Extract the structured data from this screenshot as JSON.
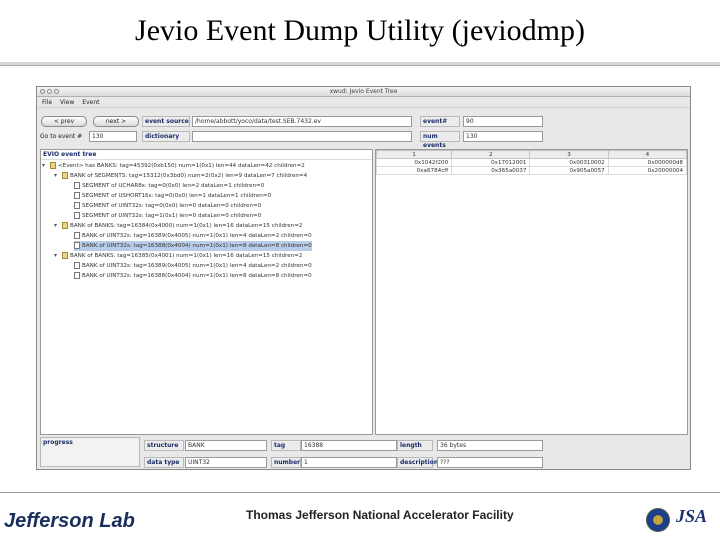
{
  "slide": {
    "title": "Jevio Event Dump Utility (jeviodmp)",
    "facility": "Thomas Jefferson National Accelerator Facility",
    "logo_text": "Jefferson Lab",
    "jsa_text": "JSA"
  },
  "window": {
    "title": "xwud: Jevio Event Tree",
    "menu": [
      "File",
      "View",
      "Event"
    ]
  },
  "toolbar": {
    "prev_label": "< prev",
    "next_label": "next >",
    "goto_label": "Go to event #",
    "goto_value": "130",
    "event_source_label": "event source",
    "event_source_value": "/home/abbott/yoco/data/test.SEB.7432.ev",
    "dictionary_label": "dictionary",
    "dictionary_value": "",
    "event_num_label": "event#",
    "event_num_value": "90",
    "num_events_label": "num events",
    "num_events_value": "130"
  },
  "tree": {
    "header": "EVIO event tree",
    "nodes": [
      {
        "text": "<Event> has BANKS: tag=45392(0xb150) num=1(0x1) len=44 dataLen=42 children=2",
        "toggle": "▾",
        "icon": "folder"
      },
      {
        "text": "BANK of SEGMENTS: tag=15312(0x3bd0) num=2(0x2) len=9 dataLen=7 children=4",
        "toggle": "▾",
        "icon": "folder"
      },
      {
        "text": "SEGMENT of UCHAR8s: tag=0(0x0) len=2 dataLen=1 children=0",
        "toggle": "",
        "icon": "file"
      },
      {
        "text": "SEGMENT of USHORT16s: tag=0(0x0) len=1 dataLen=1 children=0",
        "toggle": "",
        "icon": "file"
      },
      {
        "text": "SEGMENT of UINT32s: tag=0(0x0) len=0 dataLen=0 children=0",
        "toggle": "",
        "icon": "file"
      },
      {
        "text": "SEGMENT of UINT32s: tag=1(0x1) len=0 dataLen=0 children=0",
        "toggle": "",
        "icon": "file"
      },
      {
        "text": "BANK of BANKS: tag=16384(0x4000) num=1(0x1) len=16 dataLen=15 children=2",
        "toggle": "▾",
        "icon": "folder"
      },
      {
        "text": "BANK of UINT32s: tag=16389(0x4005) num=1(0x1) len=4 dataLen=2 children=0",
        "toggle": "",
        "icon": "file"
      },
      {
        "text": "BANK of UINT32s: tag=16388(0x4004) num=1(0x1) len=8 dataLen=8 children=0",
        "toggle": "",
        "icon": "file",
        "selected": true
      },
      {
        "text": "BANK of BANKS: tag=16385(0x4001) num=1(0x1) len=16 dataLen=15 children=2",
        "toggle": "▾",
        "icon": "folder"
      },
      {
        "text": "BANK of UINT32s: tag=16389(0x4005) num=1(0x1) len=4 dataLen=2 children=0",
        "toggle": "",
        "icon": "file"
      },
      {
        "text": "BANK of UINT32s: tag=16388(0x4004) num=1(0x1) len=8 dataLen=8 children=0",
        "toggle": "",
        "icon": "file"
      }
    ]
  },
  "table": {
    "headers": [
      "1",
      "2",
      "3",
      "4"
    ],
    "rows": [
      [
        "0x1042f200",
        "0x17012001",
        "0x00310002",
        "0x000000d8"
      ],
      [
        "0xa6784cff",
        "0x365a0037",
        "0x905a0057",
        "0x20000004"
      ]
    ]
  },
  "progress": {
    "label": "progress"
  },
  "details": {
    "structure_label": "structure",
    "structure_value": "BANK",
    "tag_label": "tag",
    "tag_value": "16388",
    "length_label": "length",
    "length_value": "36 bytes",
    "datatype_label": "data type",
    "datatype_value": "UINT32",
    "number_label": "number",
    "number_value": "1",
    "description_label": "description",
    "description_value": "???"
  }
}
